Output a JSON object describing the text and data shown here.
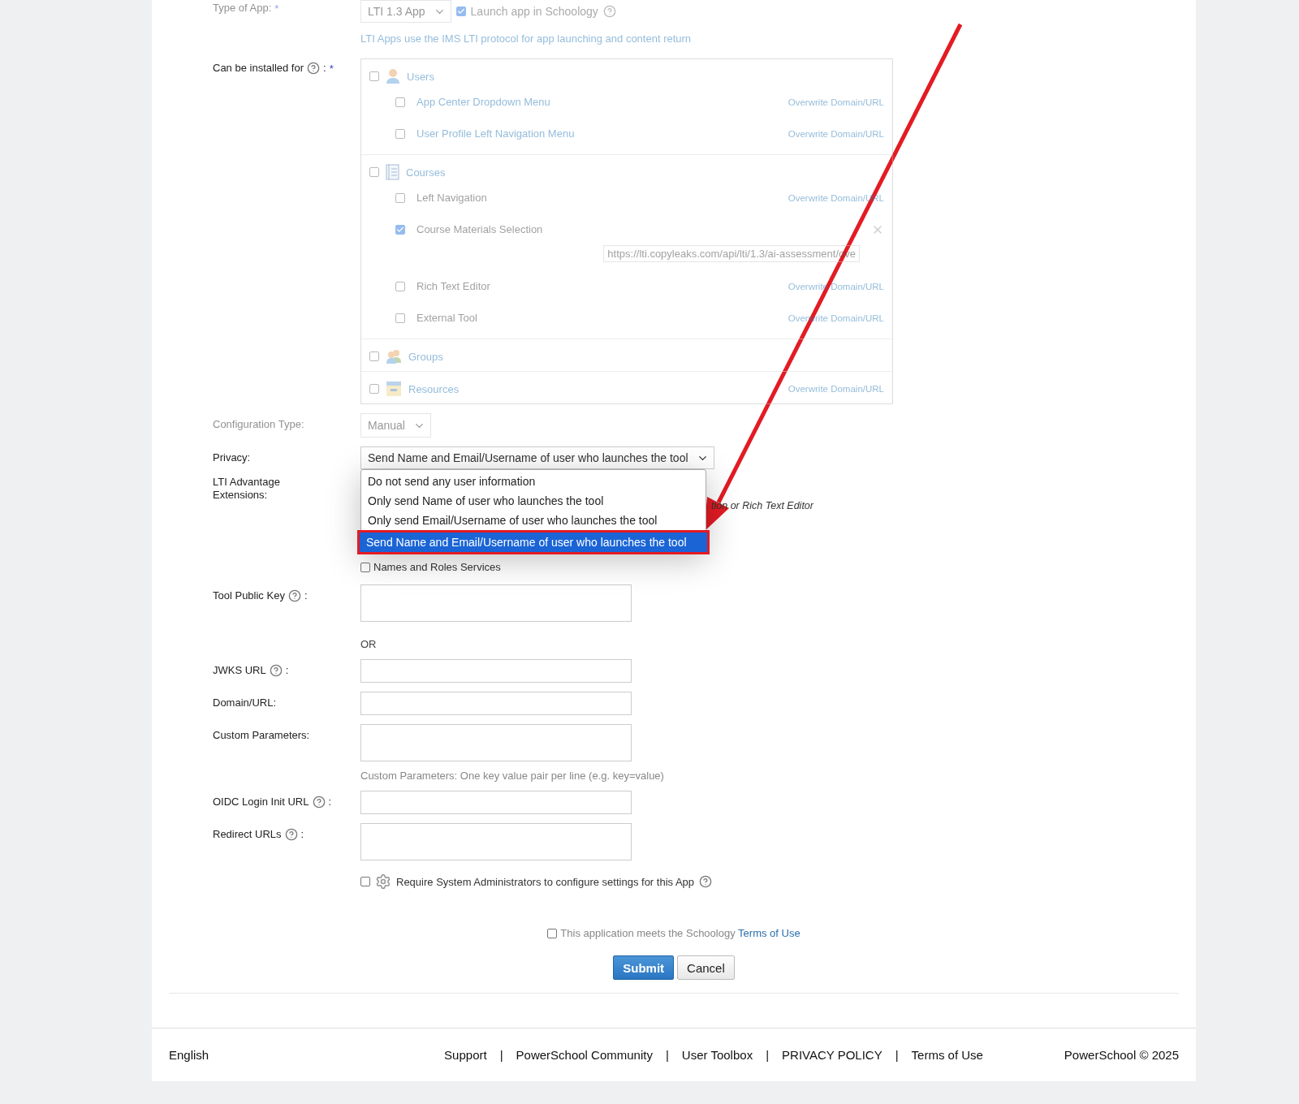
{
  "type_of_app": {
    "label": "Type of App:",
    "required_mark": "*",
    "value": "LTI 1.3 App",
    "launch_checkbox": {
      "label": "Launch app in Schoology",
      "checked": true,
      "help": true
    },
    "hint": "LTI Apps use the IMS LTI protocol for app launching and content return"
  },
  "installed_for": {
    "label": "Can be installed for",
    "help": true,
    "suffix": ":",
    "required_mark": "*",
    "sections": [
      {
        "label": "Users",
        "kind": "user",
        "checked": false,
        "items": [
          {
            "label": "App Center Dropdown Menu",
            "kind": "link",
            "checked": false,
            "action": "Overwrite Domain/URL"
          },
          {
            "label": "User Profile Left Navigation Menu",
            "kind": "link",
            "checked": false,
            "action": "Overwrite Domain/URL"
          }
        ]
      },
      {
        "label": "Courses",
        "kind": "course",
        "checked": false,
        "items": [
          {
            "label": "Left Navigation",
            "kind": "text",
            "checked": false,
            "action": "Overwrite Domain/URL"
          },
          {
            "label": "Course Materials Selection",
            "kind": "text",
            "checked": true,
            "url": "https://lti.copyleaks.com/api/lti/1.3/ai-assessment/ove"
          },
          {
            "label": "Rich Text Editor",
            "kind": "text",
            "checked": false,
            "action": "Overwrite Domain/URL"
          },
          {
            "label": "External Tool",
            "kind": "text",
            "checked": false,
            "action": "Overwrite Domain/URL"
          }
        ]
      },
      {
        "label": "Groups",
        "kind": "group",
        "checked": false
      },
      {
        "label": "Resources",
        "kind": "resource",
        "checked": false,
        "action": "Overwrite Domain/URL"
      }
    ]
  },
  "configuration_type": {
    "label": "Configuration Type:",
    "value": "Manual"
  },
  "privacy": {
    "label": "Privacy:",
    "value": "Send Name and Email/Username of user who launches the tool",
    "expanded": true,
    "options": [
      {
        "label": "Do not send any user information",
        "selected": false
      },
      {
        "label": "Only send Name of user who launches the tool",
        "selected": false
      },
      {
        "label": "Only send Email/Username of user who launches the tool",
        "selected": false
      },
      {
        "label": "Send Name and Email/Username of user who launches the tool",
        "selected": true
      }
    ]
  },
  "lti_extensions": {
    "label": "LTI Advantage Extensions:",
    "partial_note": "tion or Rich Text Editor",
    "names_roles": {
      "label": "Names and Roles Services",
      "checked": false
    }
  },
  "fields": [
    {
      "label": "Tool Public Key",
      "help": true,
      "suffix": ":",
      "kind": "textarea"
    },
    {
      "kind": "separator",
      "text": "OR"
    },
    {
      "label": "JWKS URL",
      "help": true,
      "suffix": ":",
      "kind": "input"
    },
    {
      "label": "Domain/URL:",
      "kind": "input"
    },
    {
      "label": "Custom Parameters:",
      "kind": "textarea",
      "hint": "Custom Parameters: One key value pair per line (e.g. key=value)"
    },
    {
      "label": "OIDC Login Init URL",
      "help": true,
      "suffix": ":",
      "kind": "input"
    },
    {
      "label": "Redirect URLs",
      "help": true,
      "suffix": ":",
      "kind": "textarea"
    }
  ],
  "require_admin": {
    "label": "Require System Administrators to configure settings for this App",
    "checked": false,
    "help": true
  },
  "terms": {
    "text": "This application meets the Schoology",
    "link": "Terms of Use",
    "checked": false
  },
  "buttons": [
    {
      "label": "Submit",
      "kind": "primary"
    },
    {
      "label": "Cancel",
      "kind": "secondary"
    }
  ],
  "footer": {
    "language": "English",
    "links": [
      "Support",
      "PowerSchool Community",
      "User Toolbox",
      "PRIVACY POLICY",
      "Terms of Use"
    ],
    "separator": "|",
    "copyright": "PowerSchool © 2025"
  }
}
